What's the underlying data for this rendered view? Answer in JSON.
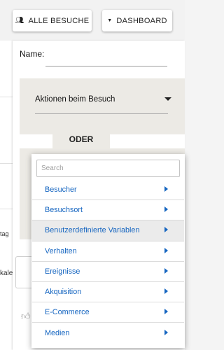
{
  "toolbar": {
    "visits_label": "ALLE BESUCHE",
    "dashboard_label": "DASHBOARD"
  },
  "background": {
    "fragment_1": "tag",
    "fragment_2": "kaler"
  },
  "segment_editor": {
    "name_label": "Name:",
    "condition_title": "Aktionen beim Besuch",
    "or_label": "ODER"
  },
  "dropdown": {
    "search_placeholder": "Search",
    "items": [
      {
        "label": "Besucher"
      },
      {
        "label": "Besuchsort"
      },
      {
        "label": "Benutzerdefinierte Variablen",
        "active": true
      },
      {
        "label": "Verhalten"
      },
      {
        "label": "Ereignisse"
      },
      {
        "label": "Akquisition"
      },
      {
        "label": "E-Commerce"
      },
      {
        "label": "Medien"
      }
    ]
  },
  "colors": {
    "accent": "#1565c0",
    "panel_grey": "#eceae5"
  }
}
